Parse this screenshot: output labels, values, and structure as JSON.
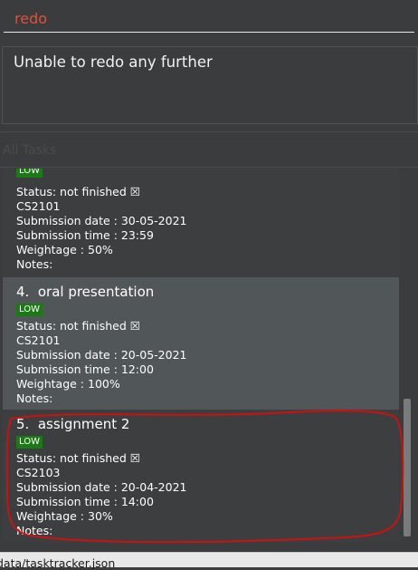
{
  "command_box": {
    "value": "redo"
  },
  "result_display": {
    "text": "Unable to redo any further"
  },
  "task_list": {
    "header": "All Tasks",
    "cards": [
      {
        "index_title": "",
        "priority": "LOW",
        "status": "Status: not finished ☒",
        "module": "CS2101",
        "submission_date": "Submission date : 30-05-2021",
        "submission_time": "Submission time : 23:59",
        "weightage": "Weightage : 50%",
        "notes": "Notes:"
      },
      {
        "index_title": "4.  oral presentation",
        "priority": "LOW",
        "status": "Status: not finished ☒",
        "module": "CS2101",
        "submission_date": "Submission date : 20-05-2021",
        "submission_time": "Submission time : 12:00",
        "weightage": "Weightage : 100%",
        "notes": "Notes:"
      },
      {
        "index_title": "5.  assignment 2",
        "priority": "LOW",
        "status": "Status: not finished ☒",
        "module": "CS2103",
        "submission_date": "Submission date : 20-04-2021",
        "submission_time": "Submission time : 14:00",
        "weightage": "Weightage : 30%",
        "notes": "Notes:"
      }
    ]
  },
  "status_bar": {
    "path": "data/tasktracker.json"
  },
  "colors": {
    "command_text": "#d9533f",
    "priority_tag": "#1c7a16",
    "annotation": "#cc1111"
  }
}
